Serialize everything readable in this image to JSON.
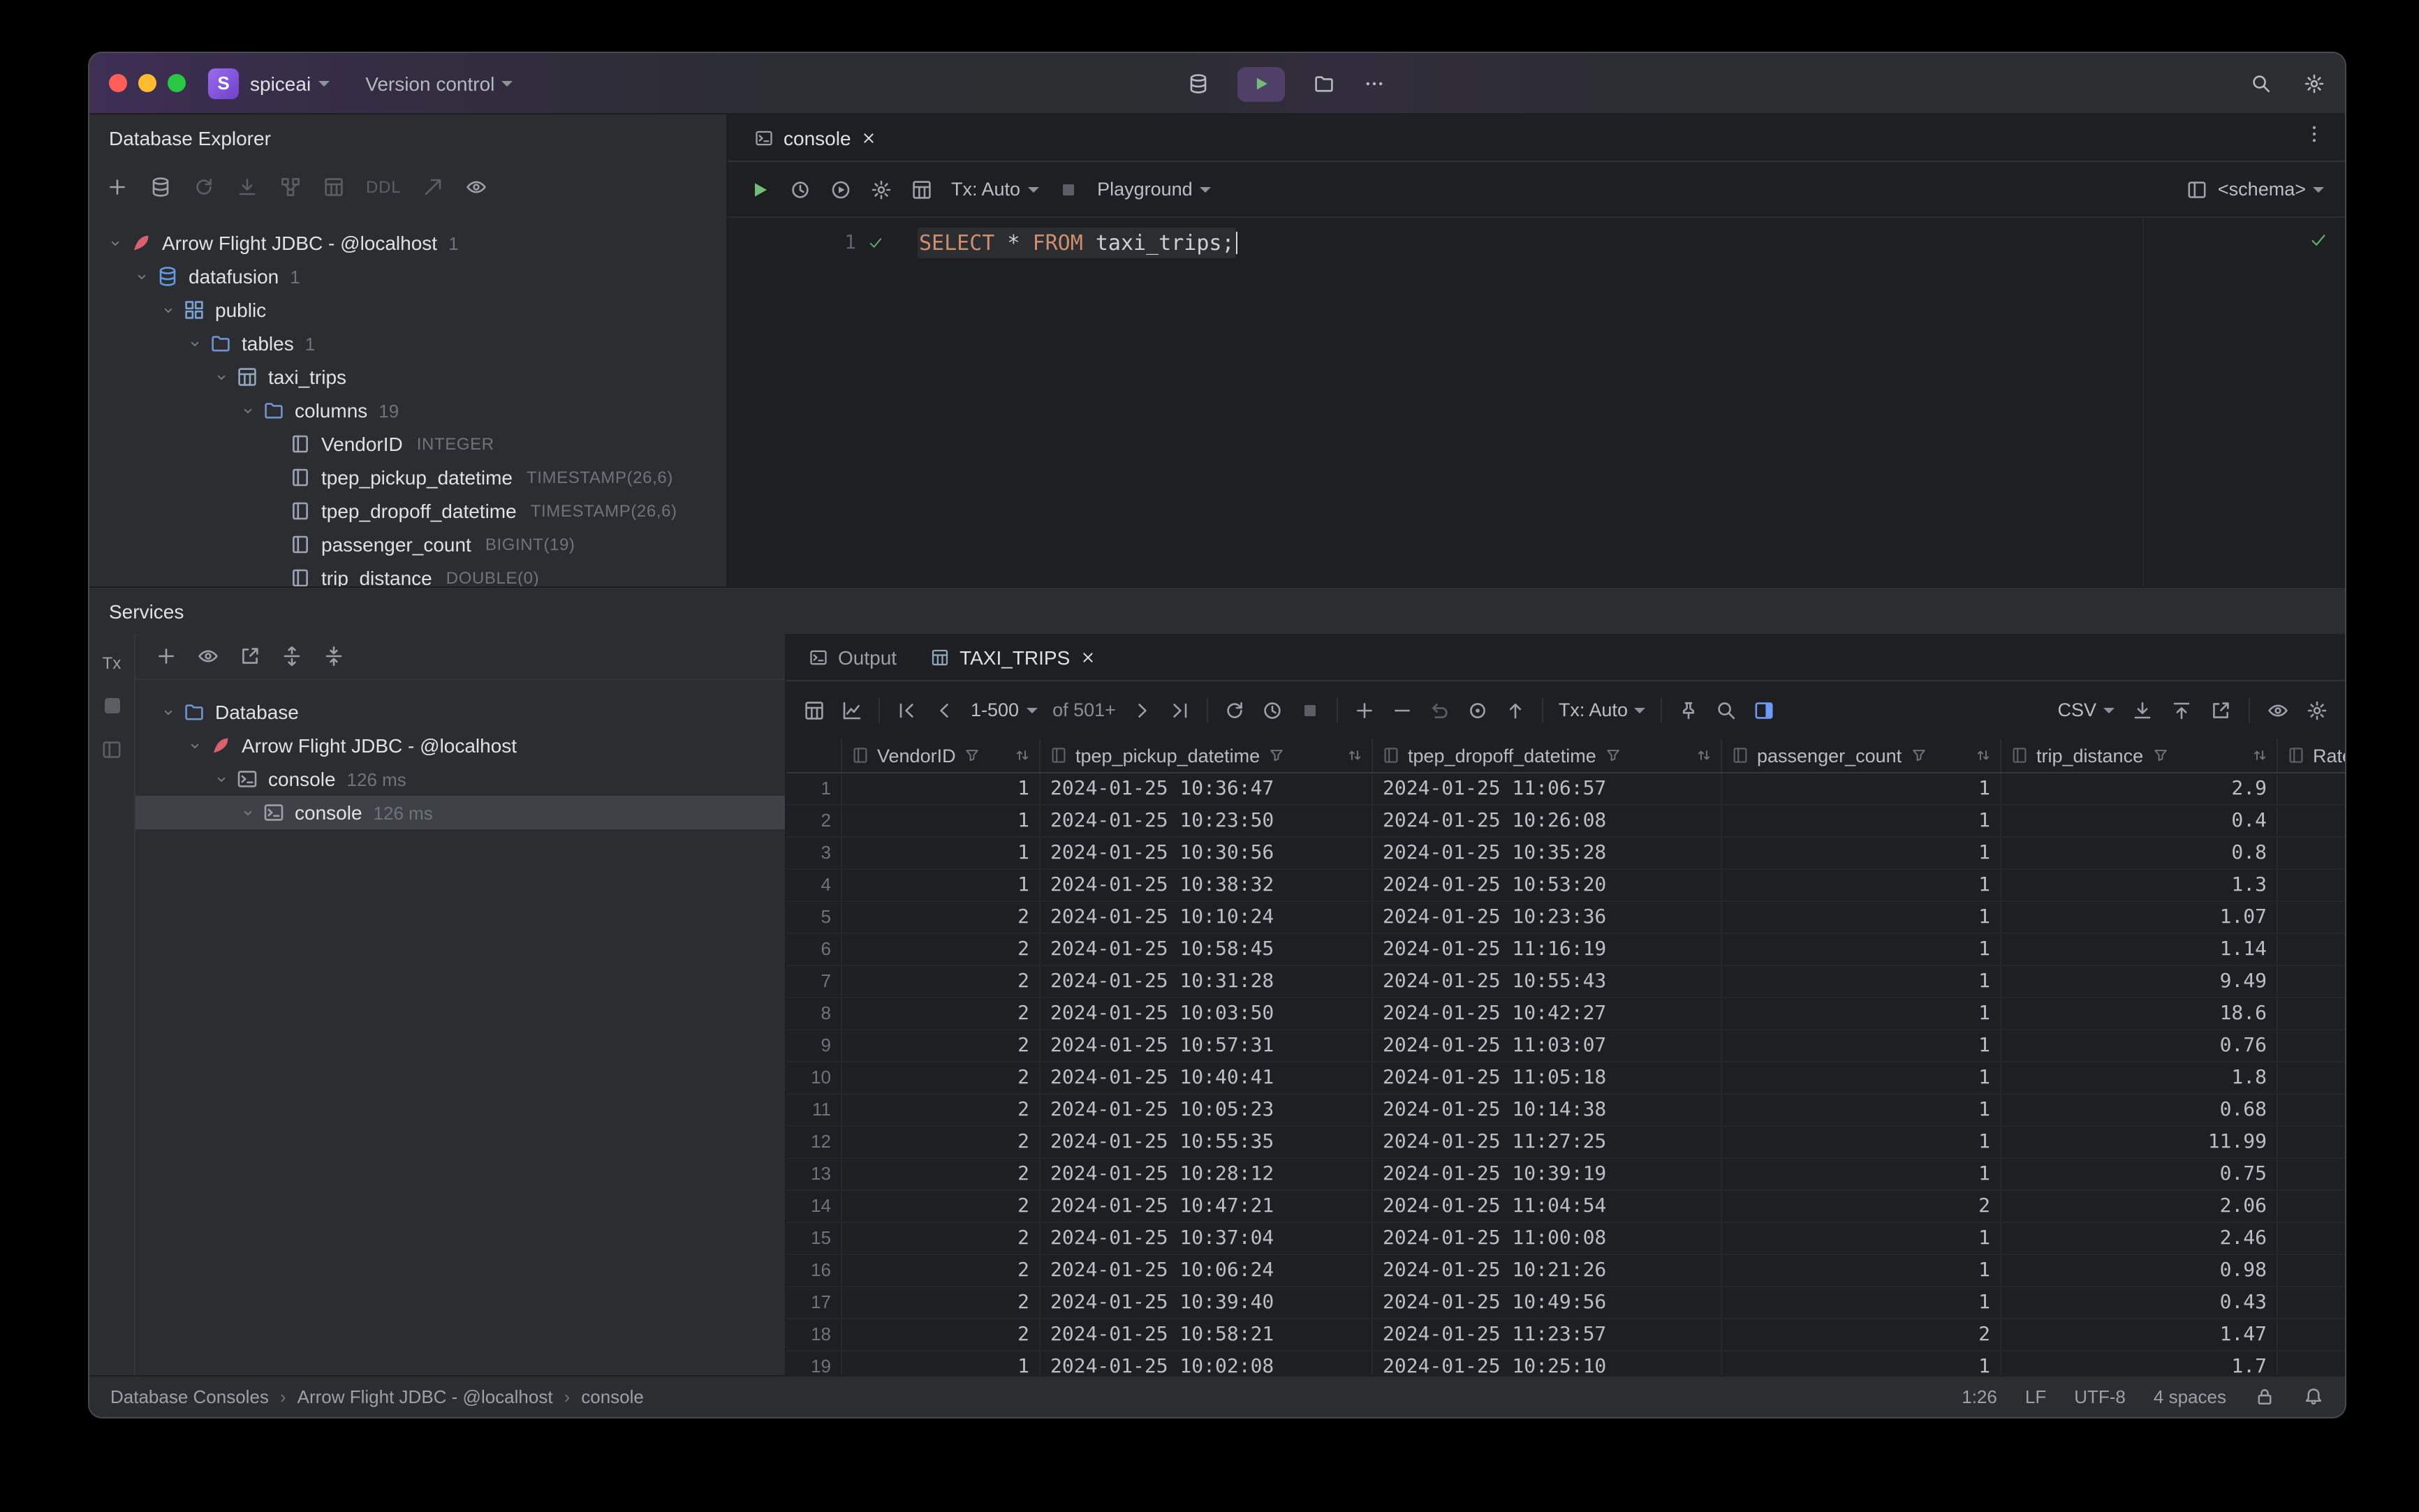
{
  "colors": {
    "accent_blue": "#3574f0",
    "sql_keyword_orange": "#cf8e6d",
    "success_green": "#5fad65",
    "brand_purple": "#8053d6",
    "run_play_green": "#73bd79"
  },
  "icons": {
    "traffic_lights": "red-yellow-green circles",
    "run-icon": "play triangle",
    "filter-icon": "funnel",
    "sort-icon": "up-down arrows"
  },
  "titlebar": {
    "project": "spiceai",
    "project_initial": "S",
    "version_control": "Version control"
  },
  "db_explorer": {
    "title": "Database Explorer",
    "ddl_label": "DDL",
    "tree": [
      {
        "label": "Arrow Flight JDBC - @localhost",
        "badge": "1",
        "depth": 0,
        "icon": "feather"
      },
      {
        "label": "datafusion",
        "badge": "1",
        "depth": 1,
        "icon": "db"
      },
      {
        "label": "public",
        "badge": "",
        "depth": 2,
        "icon": "schema"
      },
      {
        "label": "tables",
        "badge": "1",
        "depth": 3,
        "icon": "folder"
      },
      {
        "label": "taxi_trips",
        "badge": "",
        "depth": 4,
        "icon": "table"
      },
      {
        "label": "columns",
        "badge": "19",
        "depth": 5,
        "icon": "folder"
      },
      {
        "label": "VendorID",
        "type": "INTEGER",
        "depth": 6,
        "icon": "column",
        "leaf": true
      },
      {
        "label": "tpep_pickup_datetime",
        "type": "TIMESTAMP(26,6)",
        "depth": 6,
        "icon": "column",
        "leaf": true
      },
      {
        "label": "tpep_dropoff_datetime",
        "type": "TIMESTAMP(26,6)",
        "depth": 6,
        "icon": "column",
        "leaf": true
      },
      {
        "label": "passenger_count",
        "type": "BIGINT(19)",
        "depth": 6,
        "icon": "column",
        "leaf": true
      },
      {
        "label": "trip_distance",
        "type": "DOUBLE(0)",
        "depth": 6,
        "icon": "column",
        "leaf": true
      }
    ]
  },
  "editor": {
    "tab_label": "console",
    "tx": "Tx: Auto",
    "playground": "Playground",
    "schema": "<schema>",
    "line_number": "1",
    "sql_kw1": "SELECT",
    "sql_mid": " * ",
    "sql_kw2": "FROM",
    "sql_tail": " taxi_trips;"
  },
  "services": {
    "title": "Services",
    "stripe_tx": "Tx",
    "tree": [
      {
        "label": "Database",
        "depth": 0,
        "icon": "folder"
      },
      {
        "label": "Arrow Flight JDBC - @localhost",
        "depth": 1,
        "icon": "feather"
      },
      {
        "label": "console",
        "time": "126 ms",
        "depth": 2,
        "icon": "console"
      },
      {
        "label": "console",
        "time": "126 ms",
        "depth": 3,
        "icon": "console",
        "selected": true,
        "leaf": true
      }
    ]
  },
  "results": {
    "tab_output": "Output",
    "tab_table": "TAXI_TRIPS",
    "pager_range": "1-500",
    "pager_total": "of 501+",
    "tx": "Tx: Auto",
    "format": "CSV",
    "columns": [
      {
        "name": "VendorID"
      },
      {
        "name": "tpep_pickup_datetime"
      },
      {
        "name": "tpep_dropoff_datetime"
      },
      {
        "name": "passenger_count"
      },
      {
        "name": "trip_distance"
      },
      {
        "name": "Rate"
      }
    ],
    "rows": [
      {
        "n": "1",
        "c1": "1",
        "c2": "2024-01-25 10:36:47",
        "c3": "2024-01-25 11:06:57",
        "c4": "1",
        "c5": "2.9"
      },
      {
        "n": "2",
        "c1": "1",
        "c2": "2024-01-25 10:23:50",
        "c3": "2024-01-25 10:26:08",
        "c4": "1",
        "c5": "0.4"
      },
      {
        "n": "3",
        "c1": "1",
        "c2": "2024-01-25 10:30:56",
        "c3": "2024-01-25 10:35:28",
        "c4": "1",
        "c5": "0.8"
      },
      {
        "n": "4",
        "c1": "1",
        "c2": "2024-01-25 10:38:32",
        "c3": "2024-01-25 10:53:20",
        "c4": "1",
        "c5": "1.3"
      },
      {
        "n": "5",
        "c1": "2",
        "c2": "2024-01-25 10:10:24",
        "c3": "2024-01-25 10:23:36",
        "c4": "1",
        "c5": "1.07"
      },
      {
        "n": "6",
        "c1": "2",
        "c2": "2024-01-25 10:58:45",
        "c3": "2024-01-25 11:16:19",
        "c4": "1",
        "c5": "1.14"
      },
      {
        "n": "7",
        "c1": "2",
        "c2": "2024-01-25 10:31:28",
        "c3": "2024-01-25 10:55:43",
        "c4": "1",
        "c5": "9.49"
      },
      {
        "n": "8",
        "c1": "2",
        "c2": "2024-01-25 10:03:50",
        "c3": "2024-01-25 10:42:27",
        "c4": "1",
        "c5": "18.6"
      },
      {
        "n": "9",
        "c1": "2",
        "c2": "2024-01-25 10:57:31",
        "c3": "2024-01-25 11:03:07",
        "c4": "1",
        "c5": "0.76"
      },
      {
        "n": "10",
        "c1": "2",
        "c2": "2024-01-25 10:40:41",
        "c3": "2024-01-25 11:05:18",
        "c4": "1",
        "c5": "1.8"
      },
      {
        "n": "11",
        "c1": "2",
        "c2": "2024-01-25 10:05:23",
        "c3": "2024-01-25 10:14:38",
        "c4": "1",
        "c5": "0.68"
      },
      {
        "n": "12",
        "c1": "2",
        "c2": "2024-01-25 10:55:35",
        "c3": "2024-01-25 11:27:25",
        "c4": "1",
        "c5": "11.99"
      },
      {
        "n": "13",
        "c1": "2",
        "c2": "2024-01-25 10:28:12",
        "c3": "2024-01-25 10:39:19",
        "c4": "1",
        "c5": "0.75"
      },
      {
        "n": "14",
        "c1": "2",
        "c2": "2024-01-25 10:47:21",
        "c3": "2024-01-25 11:04:54",
        "c4": "2",
        "c5": "2.06"
      },
      {
        "n": "15",
        "c1": "2",
        "c2": "2024-01-25 10:37:04",
        "c3": "2024-01-25 11:00:08",
        "c4": "1",
        "c5": "2.46"
      },
      {
        "n": "16",
        "c1": "2",
        "c2": "2024-01-25 10:06:24",
        "c3": "2024-01-25 10:21:26",
        "c4": "1",
        "c5": "0.98"
      },
      {
        "n": "17",
        "c1": "2",
        "c2": "2024-01-25 10:39:40",
        "c3": "2024-01-25 10:49:56",
        "c4": "1",
        "c5": "0.43"
      },
      {
        "n": "18",
        "c1": "2",
        "c2": "2024-01-25 10:58:21",
        "c3": "2024-01-25 11:23:57",
        "c4": "2",
        "c5": "1.47"
      },
      {
        "n": "19",
        "c1": "1",
        "c2": "2024-01-25 10:02:08",
        "c3": "2024-01-25 10:25:10",
        "c4": "1",
        "c5": "1.7"
      }
    ]
  },
  "statusbar": {
    "crumbs": [
      {
        "label": "Database Consoles"
      },
      {
        "label": "Arrow Flight JDBC - @localhost"
      },
      {
        "label": "console"
      }
    ],
    "caret_pos": "1:26",
    "line_sep": "LF",
    "encoding": "UTF-8",
    "indent": "4 spaces"
  }
}
